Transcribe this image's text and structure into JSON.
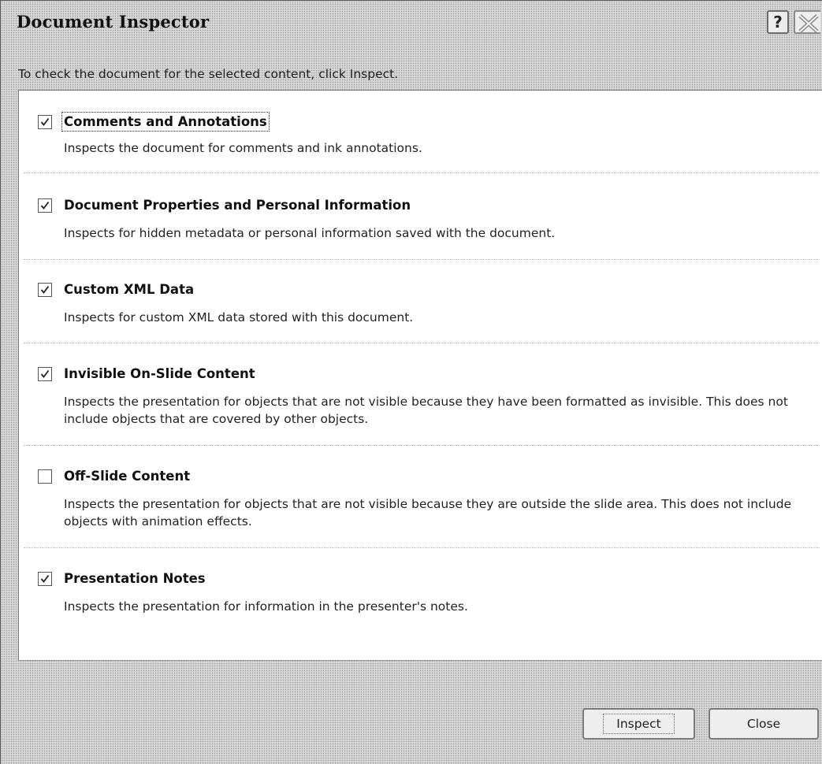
{
  "window": {
    "title": "Document Inspector",
    "help_label": "?"
  },
  "instruction": "To check the document for the selected content, click Inspect.",
  "items": [
    {
      "checked": true,
      "title": "Comments and Annotations",
      "description": "Inspects the document for comments and ink annotations."
    },
    {
      "checked": true,
      "title": "Document Properties and Personal Information",
      "description": "Inspects for hidden metadata or personal information saved with the document."
    },
    {
      "checked": true,
      "title": "Custom XML Data",
      "description": "Inspects for custom XML data stored with this document."
    },
    {
      "checked": true,
      "title": "Invisible On-Slide Content",
      "description": "Inspects the presentation for objects that are not visible because they have been formatted as invisible. This does not include objects that are covered by other objects."
    },
    {
      "checked": false,
      "title": "Off-Slide Content",
      "description": "Inspects the presentation for objects that are not visible because they are outside the slide area. This does not include objects with animation effects."
    },
    {
      "checked": true,
      "title": "Presentation Notes",
      "description": "Inspects the presentation for information in the presenter's notes."
    }
  ],
  "buttons": {
    "inspect_label": "Inspect",
    "close_label": "Close"
  }
}
